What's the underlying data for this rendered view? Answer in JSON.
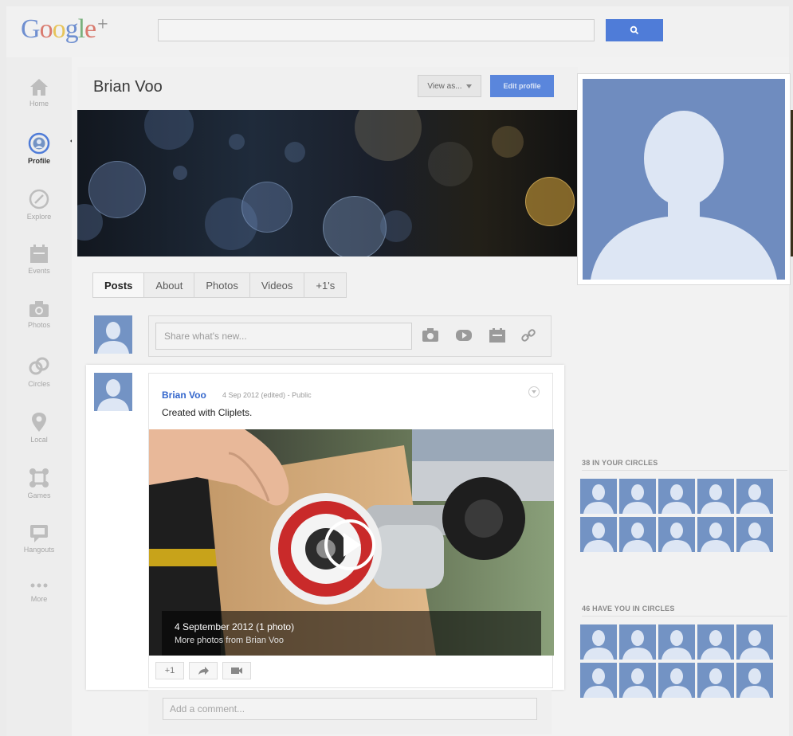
{
  "app": {
    "logo_text": "Google",
    "logo_plus": "+"
  },
  "search": {
    "value": "",
    "placeholder": ""
  },
  "nav": {
    "items": [
      {
        "label": "Home",
        "icon": "home-icon"
      },
      {
        "label": "Profile",
        "icon": "profile-icon",
        "active": true
      },
      {
        "label": "Explore",
        "icon": "compass-icon"
      },
      {
        "label": "Events",
        "icon": "calendar-icon"
      },
      {
        "label": "Photos",
        "icon": "camera-icon"
      },
      {
        "label": "Circles",
        "icon": "circles-icon"
      },
      {
        "label": "Local",
        "icon": "map-pin-icon"
      },
      {
        "label": "Games",
        "icon": "games-icon"
      },
      {
        "label": "Hangouts",
        "icon": "hangouts-icon"
      },
      {
        "label": "More",
        "icon": "more-icon"
      }
    ]
  },
  "profile": {
    "name": "Brian Voo",
    "view_as_label": "View as...",
    "edit_profile_label": "Edit profile"
  },
  "tabs": [
    "Posts",
    "About",
    "Photos",
    "Videos",
    "+1's"
  ],
  "share": {
    "placeholder": "Share what's new..."
  },
  "post": {
    "author": "Brian Voo",
    "date": "4 Sep 2012 (edited)",
    "separator": "-",
    "visibility": "Public",
    "text": "Created with Cliplets.",
    "album_title": "4 September 2012 (1 photo)",
    "album_link": "More photos from Brian Voo",
    "plus_one_label": "+1"
  },
  "comment": {
    "placeholder": "Add a comment..."
  },
  "circles": {
    "in_your_circles": "38 IN YOUR CIRCLES",
    "have_you_in_circles": "46 HAVE YOU IN CIRCLES"
  },
  "colors": {
    "accent_blue": "#4f7cd8",
    "link_blue": "#3366cc",
    "avatar_blue": "#7393c4"
  }
}
